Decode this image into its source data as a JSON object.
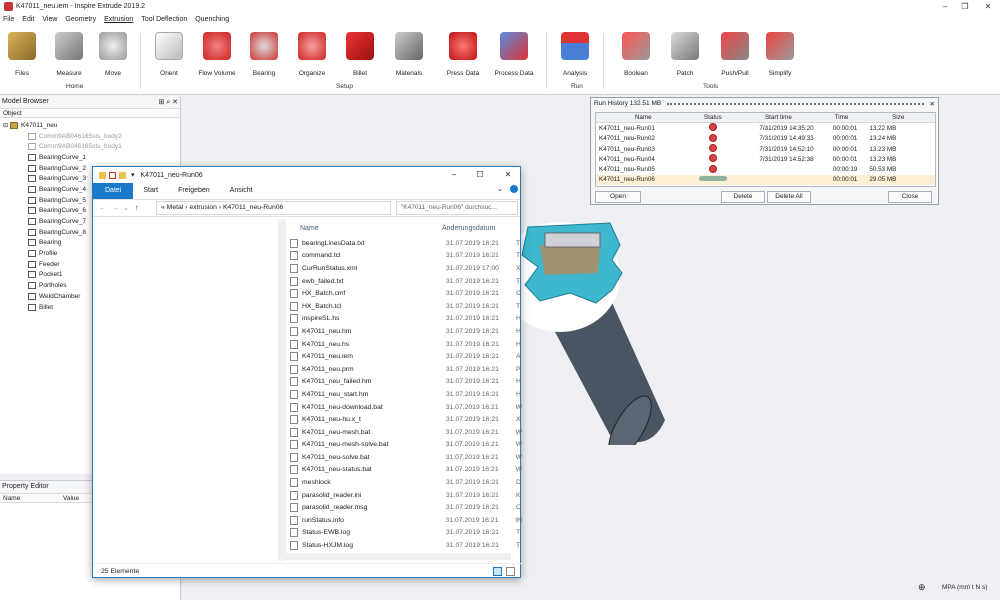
{
  "window": {
    "title": "K47011_neu.iem - Inspire Extrude 2019.2",
    "controls": [
      "–",
      "❐",
      "✕"
    ]
  },
  "menu": [
    "File",
    "Edit",
    "View",
    "Geometry",
    "Extrusion",
    "Tool Deflection",
    "Quenching"
  ],
  "ribbon": {
    "buttons": [
      "Files",
      "Measure",
      "Move",
      "Orient",
      "Flow Volume",
      "Bearing",
      "Organize",
      "Billet",
      "Materials",
      "Press Data",
      "Process Data",
      "Analysis",
      "Boolean",
      "Patch",
      "Push/Pull",
      "Simplify"
    ],
    "groups": [
      "Home",
      "Setup",
      "Run",
      "Tools"
    ]
  },
  "model_browser": {
    "title": "Model Browser",
    "column": "Object",
    "root": "K47011_neu",
    "items": [
      {
        "label": "Comm9AB046165sts_body2",
        "dim": true
      },
      {
        "label": "Comm9AB046165sts_body1",
        "dim": true
      },
      {
        "label": "BearingCurve_1",
        "dim": false
      },
      {
        "label": "BearingCurve_2",
        "dim": false
      },
      {
        "label": "BearingCurve_3",
        "dim": false
      },
      {
        "label": "BearingCurve_4",
        "dim": false
      },
      {
        "label": "BearingCurve_5",
        "dim": false
      },
      {
        "label": "BearingCurve_6",
        "dim": false
      },
      {
        "label": "BearingCurve_7",
        "dim": false
      },
      {
        "label": "BearingCurve_8",
        "dim": false
      },
      {
        "label": "Bearing",
        "dim": false
      },
      {
        "label": "Profile",
        "dim": false
      },
      {
        "label": "Feeder",
        "dim": false
      },
      {
        "label": "Pocket1",
        "dim": false
      },
      {
        "label": "Portholes",
        "dim": false
      },
      {
        "label": "WeldChamber",
        "dim": false
      },
      {
        "label": "Billet",
        "dim": false
      }
    ]
  },
  "property_editor": {
    "title": "Property Editor",
    "col_name": "Name",
    "col_value": "Value"
  },
  "run_history": {
    "title": "Run History 132.51 MB",
    "columns": [
      "Name",
      "Status",
      "Start time",
      "Time",
      "Size"
    ],
    "rows": [
      {
        "name": "K47011_neu-Run01",
        "status": "error",
        "start": "7/31/2019 14:35:20",
        "time": "00:00:01",
        "size": "13.22 MB"
      },
      {
        "name": "K47011_neu-Run02",
        "status": "error",
        "start": "7/31/2019 14:49:33",
        "time": "00:00:01",
        "size": "13.24 MB"
      },
      {
        "name": "K47011_neu-Run03",
        "status": "error",
        "start": "7/31/2019 14:52:10",
        "time": "00:00:01",
        "size": "13.23 MB"
      },
      {
        "name": "K47011_neu-Run04",
        "status": "error",
        "start": "7/31/2019 14:52:38",
        "time": "00:00:01",
        "size": "13.23 MB"
      },
      {
        "name": "K47011_neu-Run05",
        "status": "error",
        "start": "",
        "time": "00:00:19",
        "size": "50.53 MB"
      },
      {
        "name": "K47011_neu-Run06",
        "status": "running",
        "start": "",
        "time": "00:00:01",
        "size": "29.05 MB"
      }
    ],
    "buttons": {
      "open": "Open",
      "delete": "Delete",
      "delete_all": "Delete All",
      "close": "Close"
    }
  },
  "explorer": {
    "title": "K47011_neu-Run06",
    "tabs": [
      "Datei",
      "Start",
      "Freigeben",
      "Ansicht"
    ],
    "address": "«  Metal  ›  extrusion  ›  K47011_neu-Run06",
    "search_placeholder": "\"K47011_neu-Run06\" durchsuc...",
    "columns": {
      "name": "Name",
      "date": "Änderungsdatum"
    },
    "files": [
      {
        "name": "bearingLinesData.txt",
        "date": "31.07.2019 16:21",
        "type": "T"
      },
      {
        "name": "command.tcl",
        "date": "31.07.2019 16:21",
        "type": "T"
      },
      {
        "name": "CurRunStatus.xml",
        "date": "31.07.2019 17:00",
        "type": "X"
      },
      {
        "name": "ewb_failed.txt",
        "date": "31.07.2019 16:21",
        "type": "T"
      },
      {
        "name": "HX_Batch.cmf",
        "date": "31.07.2019 16:21",
        "type": "C"
      },
      {
        "name": "HX_Batch.tcl",
        "date": "31.07.2019 16:21",
        "type": "T"
      },
      {
        "name": "inspireSL.hs",
        "date": "31.07.2019 16:21",
        "type": "H"
      },
      {
        "name": "K47011_neu.hm",
        "date": "31.07.2019 16:21",
        "type": "H"
      },
      {
        "name": "K47011_neu.hs",
        "date": "31.07.2019 16:21",
        "type": "H"
      },
      {
        "name": "K47011_neu.iem",
        "date": "31.07.2019 16:21",
        "type": "A"
      },
      {
        "name": "K47011_neu.prm",
        "date": "31.07.2019 16:21",
        "type": "P"
      },
      {
        "name": "K47011_neu_failed.hm",
        "date": "31.07.2019 16:21",
        "type": "H"
      },
      {
        "name": "K47011_neu_start.hm",
        "date": "31.07.2019 16:21",
        "type": "H"
      },
      {
        "name": "K47011_neu-download.bat",
        "date": "31.07.2019 16:21",
        "type": "W"
      },
      {
        "name": "K47011_neu-hu.x_t",
        "date": "31.07.2019 16:21",
        "type": "X"
      },
      {
        "name": "K47011_neu-mesh.bat",
        "date": "31.07.2019 16:21",
        "type": "W"
      },
      {
        "name": "K47011_neu-mesh-solve.bat",
        "date": "31.07.2019 16:21",
        "type": "W"
      },
      {
        "name": "K47011_neu-solve.bat",
        "date": "31.07.2019 16:21",
        "type": "W"
      },
      {
        "name": "K47011_neu-status.bat",
        "date": "31.07.2019 16:21",
        "type": "W"
      },
      {
        "name": "meshlock",
        "date": "31.07.2019 16:21",
        "type": "D"
      },
      {
        "name": "parasolid_reader.ini",
        "date": "31.07.2019 16:21",
        "type": "K"
      },
      {
        "name": "parasolid_reader.msg",
        "date": "31.07.2019 16:21",
        "type": "O"
      },
      {
        "name": "runStatus.info",
        "date": "31.07.2019 16:21",
        "type": "IN"
      },
      {
        "name": "Status-EWB.log",
        "date": "31.07.2019 16:21",
        "type": "T"
      },
      {
        "name": "Status-HXJM.log",
        "date": "31.07.2019 16:21",
        "type": "T"
      }
    ],
    "status": "25 Elemente"
  },
  "statusbar": {
    "units": "MPA (mm t N s)"
  },
  "colors": {
    "accent": "#1979ca",
    "error": "#d94040",
    "selected_row": "#fbf0d4",
    "profile": "#3fb7cf"
  }
}
